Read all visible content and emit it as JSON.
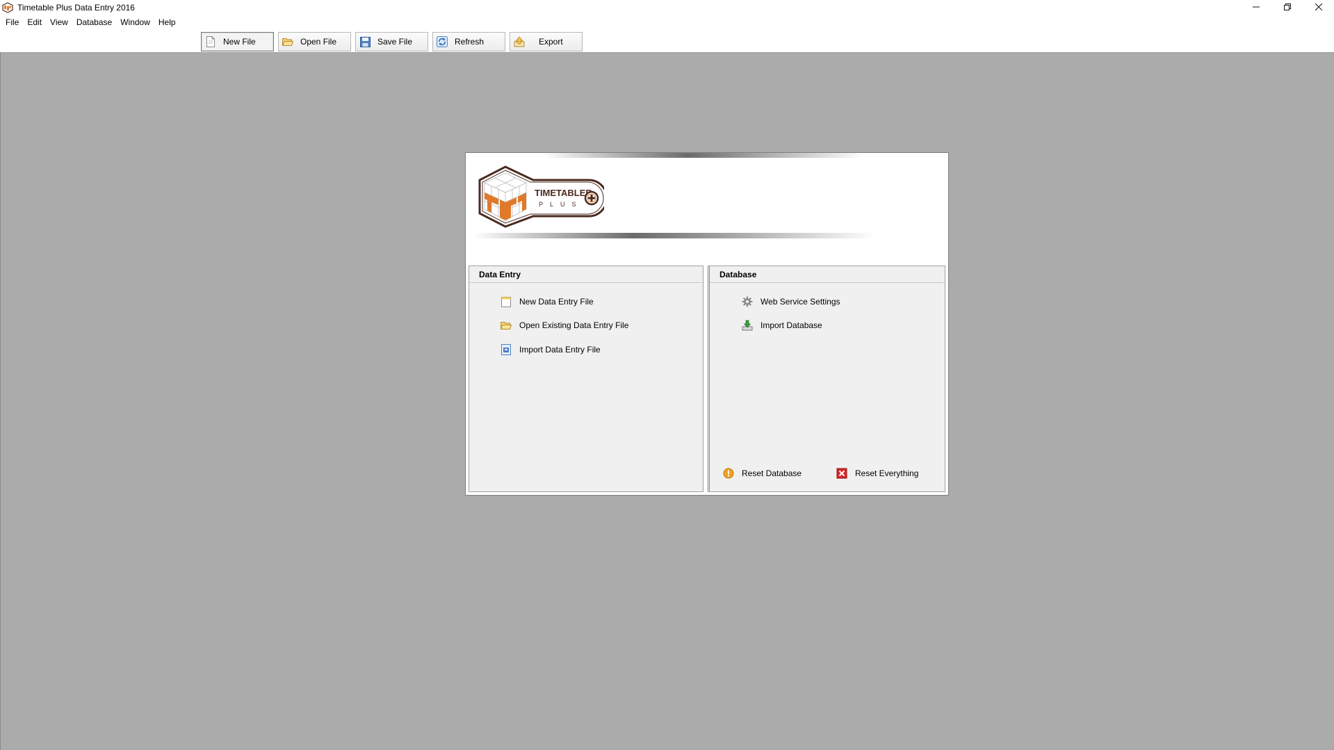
{
  "window": {
    "title": "Timetable Plus Data Entry 2016",
    "app_icon": "timetabler-cube-icon",
    "controls": [
      "minimize-icon",
      "restore-icon",
      "close-icon"
    ]
  },
  "menu": {
    "items": [
      {
        "label": "File"
      },
      {
        "label": "Edit"
      },
      {
        "label": "View"
      },
      {
        "label": "Database"
      },
      {
        "label": "Window"
      },
      {
        "label": "Help"
      }
    ]
  },
  "toolbar": {
    "buttons": [
      {
        "label": "New File",
        "icon": "new-file-icon",
        "active": true
      },
      {
        "label": "Open File",
        "icon": "folder-open-icon"
      },
      {
        "label": "Save File",
        "icon": "save-icon"
      },
      {
        "label": "Refresh",
        "icon": "refresh-icon"
      },
      {
        "label": "Export",
        "icon": "export-icon"
      }
    ]
  },
  "start_page": {
    "logo": {
      "word": "TIMETABLER",
      "subword": "PLUS"
    },
    "data_entry": {
      "header": "Data Entry",
      "links": [
        {
          "label": "New Data Entry File",
          "icon": "new-document-icon"
        },
        {
          "label": "Open Existing Data Entry File",
          "icon": "folder-open-icon"
        },
        {
          "label": "Import Data Entry File",
          "icon": "import-file-icon"
        }
      ]
    },
    "database": {
      "header": "Database",
      "links": [
        {
          "label": "Web Service Settings",
          "icon": "gear-icon"
        },
        {
          "label": "Import Database",
          "icon": "download-icon"
        }
      ],
      "reset_database": {
        "label": "Reset Database",
        "icon": "warning-icon"
      },
      "reset_everything": {
        "label": "Reset Everything",
        "icon": "error-x-icon"
      }
    }
  },
  "colors": {
    "workspace_bg": "#ababab",
    "panel_bg": "#f0f0f0",
    "logo_orange": "#e07a2a",
    "logo_brown": "#4a2a1f"
  }
}
